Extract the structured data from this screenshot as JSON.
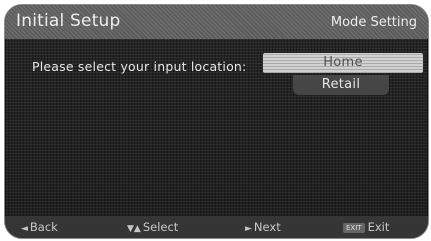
{
  "header": {
    "title": "Initial Setup",
    "mode": "Mode Setting"
  },
  "main": {
    "prompt": "Please select your input location:",
    "options": [
      {
        "label": "Home",
        "selected": true
      },
      {
        "label": "Retail",
        "selected": false
      }
    ]
  },
  "footer": {
    "back": {
      "icon": "◄",
      "label": "Back"
    },
    "select": {
      "icon": "▼▲",
      "label": "Select"
    },
    "next": {
      "icon": "►",
      "label": "Next"
    },
    "exit": {
      "key": "EXIT",
      "label": "Exit"
    }
  }
}
